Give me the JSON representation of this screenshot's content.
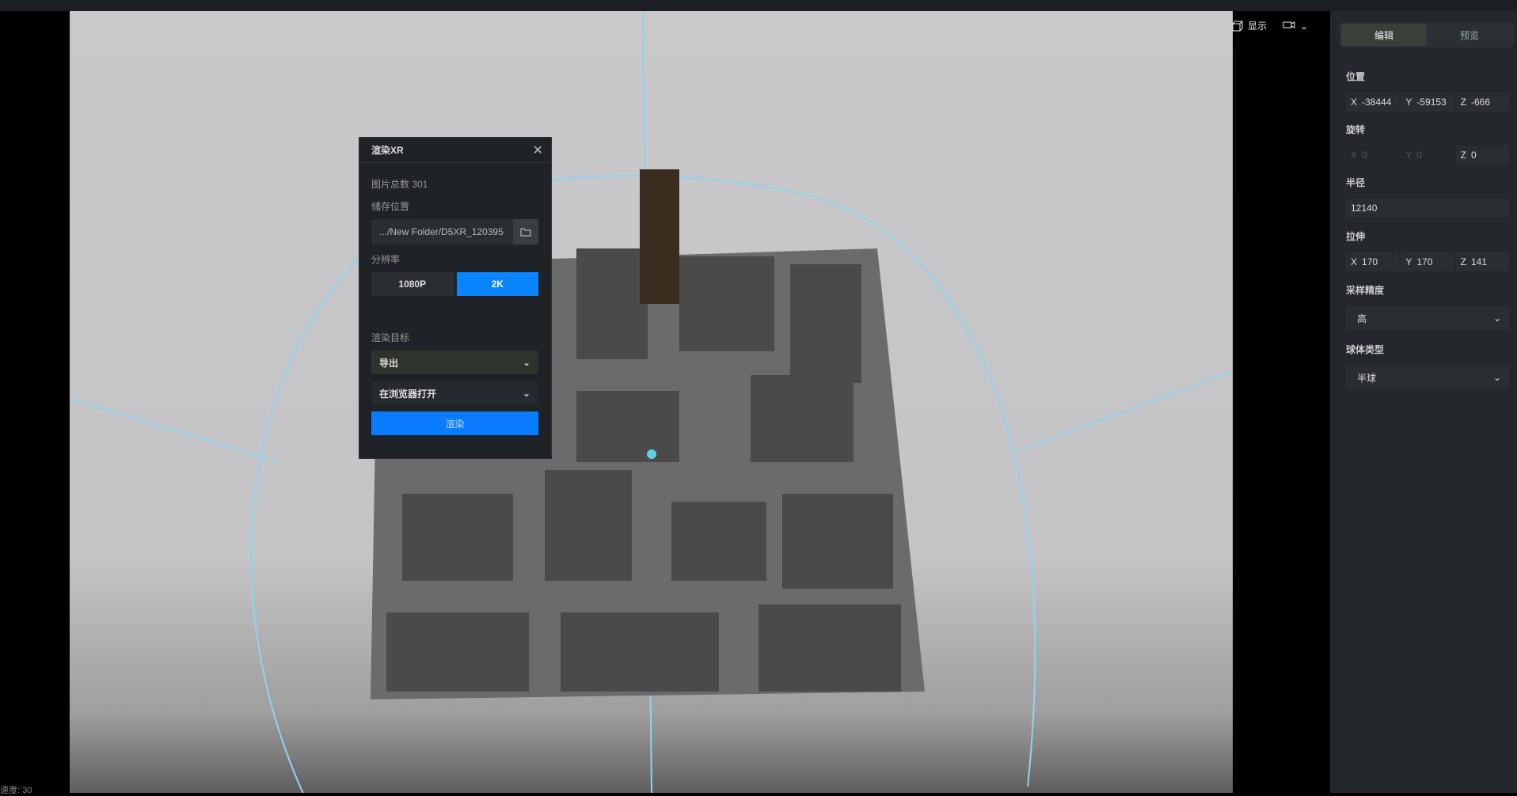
{
  "viewport": {
    "display_label": "显示",
    "speed_text": "速度: 30"
  },
  "panel": {
    "tabs": [
      "编辑",
      "预览"
    ],
    "position": {
      "label": "位置",
      "x": "-38444",
      "y": "-59153",
      "z": "-666"
    },
    "rotation": {
      "label": "旋转",
      "x": "0",
      "y": "0",
      "z": "0"
    },
    "radius": {
      "label": "半径",
      "value": "12140"
    },
    "stretch": {
      "label": "拉伸",
      "x": "170",
      "y": "170",
      "z": "141"
    },
    "sampling": {
      "label": "采样精度",
      "value": "高"
    },
    "sphere_type": {
      "label": "球体类型",
      "value": "半球"
    },
    "axis": {
      "x": "X",
      "y": "Y",
      "z": "Z"
    }
  },
  "dialog": {
    "title": "渲染XR",
    "image_count": "图片总数 301",
    "storage_label": "储存位置",
    "storage_path": ".../New Folder/D5XR_120395",
    "resolution_label": "分辨率",
    "res_options": [
      "1080P",
      "2K"
    ],
    "target_label": "渲染目标",
    "target_value": "导出",
    "open_value": "在浏览器打开",
    "render_button": "渲染"
  },
  "colors": {
    "accent": "#0a84ff",
    "panel": "#24272c"
  }
}
